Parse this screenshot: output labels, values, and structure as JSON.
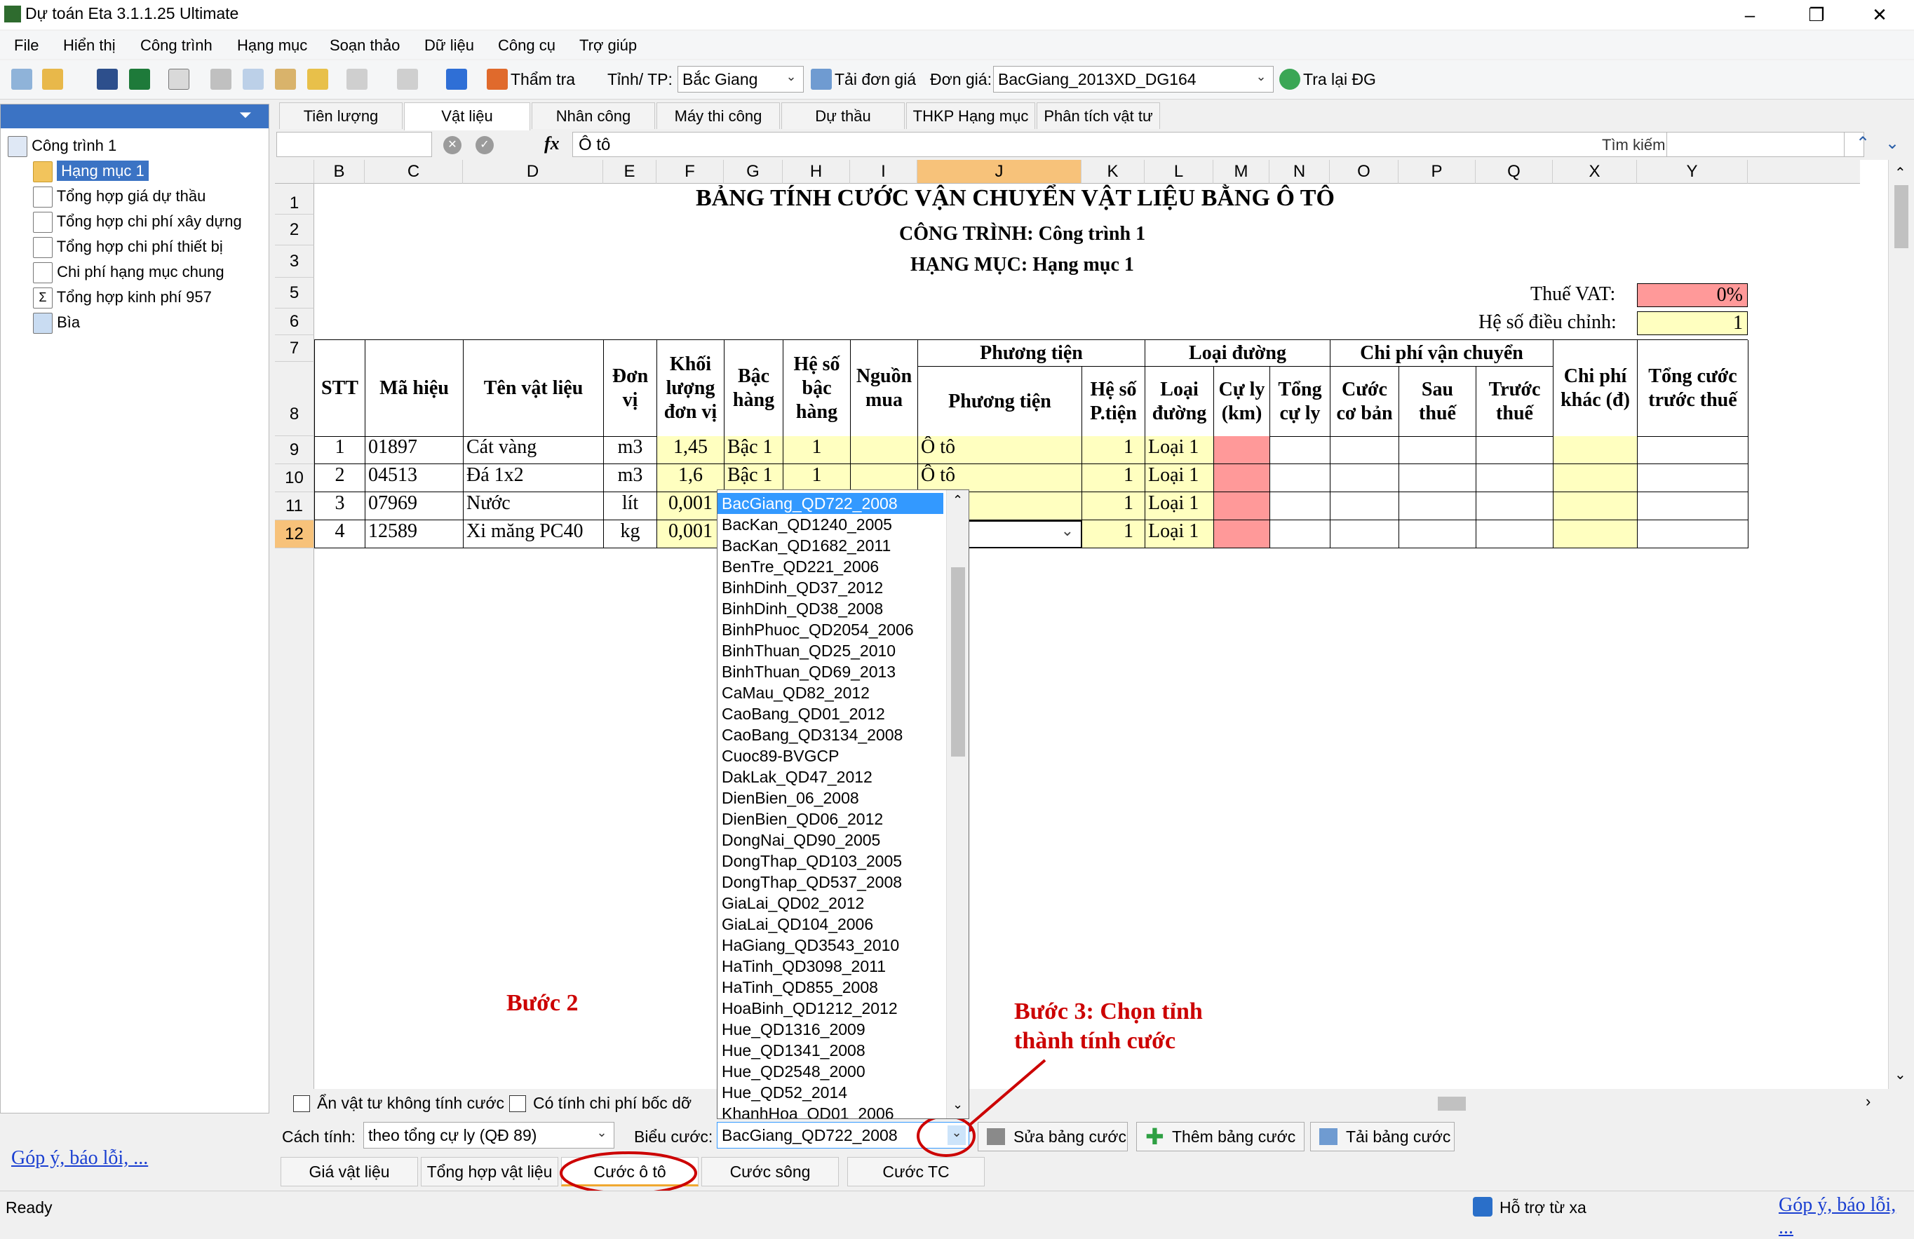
{
  "window": {
    "title": "Dự toán Eta 3.1.1.25 Ultimate"
  },
  "menu": [
    "File",
    "Hiển thị",
    "Công trình",
    "Hạng mục",
    "Soạn thảo",
    "Dữ liệu",
    "Công cụ",
    "Trợ giúp"
  ],
  "toolbar": {
    "check_label": "Thẩm tra",
    "province_label": "Tỉnh/ TP:",
    "province_value": "Bắc Giang",
    "load_price_label": "Tải đơn giá",
    "price_label": "Đơn giá:",
    "price_value": "BacGiang_2013XD_DG164",
    "lookup_label": "Tra lại ĐG"
  },
  "tree": {
    "root": "Công trình 1",
    "items": [
      "Hạng mục 1",
      "Tổng hợp giá dự thầu",
      "Tổng hợp chi phí xây dựng",
      "Tổng hợp chi phí thiết bị",
      "Chi phí hạng mục chung",
      "Tổng hợp kinh phí 957",
      "Bìa"
    ]
  },
  "top_tabs": [
    "Tiên lượng",
    "Vật liệu",
    "Nhân công",
    "Máy thi công",
    "Dự thầu",
    "THKP Hạng mục",
    "Phân tích vật tư"
  ],
  "formula": {
    "value": "Ô tô",
    "fx": "fx",
    "search_label": "Tìm kiếm"
  },
  "columns": [
    "B",
    "C",
    "D",
    "E",
    "F",
    "G",
    "H",
    "I",
    "J",
    "K",
    "L",
    "M",
    "N",
    "O",
    "P",
    "Q",
    "X",
    "Y"
  ],
  "rows": [
    "1",
    "2",
    "3",
    "5",
    "6",
    "7",
    "8",
    "9",
    "10",
    "11",
    "12"
  ],
  "sheet": {
    "title": "BẢNG TÍNH CƯỚC VẬN CHUYỂN VẬT LIỆU BẰNG Ô TÔ",
    "project": "CÔNG TRÌNH: Công trình 1",
    "item": "HẠNG MỤC: Hạng mục 1",
    "vat_label": "Thuế VAT:",
    "vat_value": "0%",
    "adjust_label": "Hệ số điều chỉnh:",
    "adjust_value": "1",
    "headers": {
      "stt": "STT",
      "ma": "Mã hiệu",
      "ten": "Tên vật liệu",
      "dv": "Đơn vị",
      "kl": "Khối lượng đơn vị",
      "bac": "Bậc hàng",
      "hsb": "Hệ số bậc hàng",
      "nguon": "Nguồn mua",
      "pt_group": "Phương tiện",
      "pt": "Phương tiện",
      "hspt": "Hệ số P.tiện",
      "ld_group": "Loại đường",
      "ld": "Loại đường",
      "cl": "Cự ly (km)",
      "tcl": "Tổng cự ly",
      "cp_group": "Chi phí vận chuyển",
      "cb": "Cước cơ bản",
      "sau": "Sau thuế",
      "truoc": "Trước thuế",
      "cpk": "Chi phí khác (đ)",
      "tong": "Tổng cước trước thuế"
    },
    "data": [
      {
        "stt": "1",
        "ma": "01897",
        "ten": "Cát vàng",
        "dv": "m3",
        "kl": "1,45",
        "bac": "Bậc 1",
        "hsb": "1",
        "pt": "Ô tô",
        "hspt": "1",
        "ld": "Loại 1"
      },
      {
        "stt": "2",
        "ma": "04513",
        "ten": "Đá 1x2",
        "dv": "m3",
        "kl": "1,6",
        "bac": "Bậc 1",
        "hsb": "1",
        "pt": "Ô tô",
        "hspt": "1",
        "ld": "Loại 1"
      },
      {
        "stt": "3",
        "ma": "07969",
        "ten": "Nước",
        "dv": "lít",
        "kl": "0,001",
        "bac": "",
        "hsb": "",
        "pt": "",
        "hspt": "1",
        "ld": "Loại 1"
      },
      {
        "stt": "4",
        "ma": "12589",
        "ten": "Xi măng PC40",
        "dv": "kg",
        "kl": "0,001",
        "bac": "",
        "hsb": "",
        "pt": "",
        "hspt": "1",
        "ld": "Loại 1"
      }
    ]
  },
  "dropdown": {
    "selected": "BacGiang_QD722_2008",
    "options": [
      "BacGiang_QD722_2008",
      "BacKan_QD1240_2005",
      "BacKan_QD1682_2011",
      "BenTre_QD221_2006",
      "BinhDinh_QD37_2012",
      "BinhDinh_QD38_2008",
      "BinhPhuoc_QD2054_2006",
      "BinhThuan_QD25_2010",
      "BinhThuan_QD69_2013",
      "CaMau_QD82_2012",
      "CaoBang_QD01_2012",
      "CaoBang_QD3134_2008",
      "Cuoc89-BVGCP",
      "DakLak_QD47_2012",
      "DienBien_06_2008",
      "DienBien_QD06_2012",
      "DongNai_QD90_2005",
      "DongThap_QD103_2005",
      "DongThap_QD537_2008",
      "GiaLai_QD02_2012",
      "GiaLai_QD104_2006",
      "HaGiang_QD3543_2010",
      "HaTinh_QD3098_2011",
      "HaTinh_QD855_2008",
      "HoaBinh_QD1212_2012",
      "Hue_QD1316_2009",
      "Hue_QD1341_2008",
      "Hue_QD2548_2000",
      "Hue_QD52_2014",
      "KhanhHoa_QD01_2006"
    ]
  },
  "bottom": {
    "hide_label": "Ẩn vật tư không tính cước",
    "loading_label": "Có tính chi phí bốc dỡ",
    "method_label": "Cách tính:",
    "method_value": "theo tổng cự ly (QĐ 89)",
    "rate_label": "Biểu cước:",
    "rate_value": "BacGiang_QD722_2008",
    "edit_btn": "Sửa bảng cước",
    "add_btn": "Thêm bảng cước",
    "load_btn": "Tải bảng cước",
    "feedback": "Góp ý, báo lỗi, ...",
    "tabs": [
      "Giá vật liệu",
      "Tổng hợp vật liệu",
      "Cước ô tô",
      "Cước sông",
      "Cước TC"
    ]
  },
  "annotations": {
    "step2": "Bước 2",
    "step3_line1": "Bước 3: Chọn tỉnh",
    "step3_line2": "thành tính cước"
  },
  "status": {
    "left": "Ready",
    "remote": "Hỗ trợ từ xa",
    "feedback": "Góp ý, báo lỗi, ..."
  },
  "colors": {
    "accent": "#3399ff",
    "selection": "#3b73c4",
    "yellow_cell": "#ffffc0",
    "pink_cell": "#ff9999",
    "annotation": "#cc0000"
  }
}
